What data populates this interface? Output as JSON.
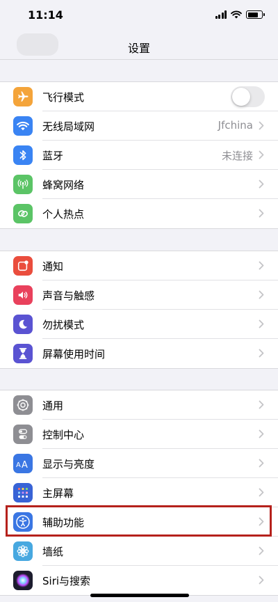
{
  "status_bar": {
    "time": "11:14"
  },
  "nav": {
    "title": "设置"
  },
  "groups": [
    [
      {
        "label": "飞行模式",
        "icon": "airplane-icon",
        "color": "#f4a43a",
        "accessory": "toggle",
        "toggle_on": false
      },
      {
        "label": "无线局域网",
        "icon": "wifi-icon",
        "color": "#3a84f3",
        "value": "Jfchina"
      },
      {
        "label": "蓝牙",
        "icon": "bluetooth-icon",
        "color": "#3a84f3",
        "value": "未连接"
      },
      {
        "label": "蜂窝网络",
        "icon": "antenna-icon",
        "color": "#5bc466"
      },
      {
        "label": "个人热点",
        "icon": "hotspot-link-icon",
        "color": "#5bc466"
      }
    ],
    [
      {
        "label": "通知",
        "icon": "notification-icon",
        "color": "#ea4d3d"
      },
      {
        "label": "声音与触感",
        "icon": "speaker-icon",
        "color": "#e9415c"
      },
      {
        "label": "勿扰模式",
        "icon": "moon-icon",
        "color": "#5a53d2"
      },
      {
        "label": "屏幕使用时间",
        "icon": "hourglass-icon",
        "color": "#5a53d2"
      }
    ],
    [
      {
        "label": "通用",
        "icon": "gear-icon",
        "color": "#8e8e93"
      },
      {
        "label": "控制中心",
        "icon": "switches-icon",
        "color": "#8e8e93"
      },
      {
        "label": "显示与亮度",
        "icon": "text-size-icon",
        "color": "#3a76e3"
      },
      {
        "label": "主屏幕",
        "icon": "home-grid-icon",
        "color": "#3863d6"
      },
      {
        "label": "辅助功能",
        "icon": "accessibility-icon",
        "color": "#3a76e3"
      },
      {
        "label": "墙纸",
        "icon": "flower-icon",
        "color": "#47a8e0"
      },
      {
        "label": "Siri与搜索",
        "icon": "siri-icon",
        "color": "#1c1c2e"
      }
    ]
  ],
  "highlighted_item": "辅助功能"
}
